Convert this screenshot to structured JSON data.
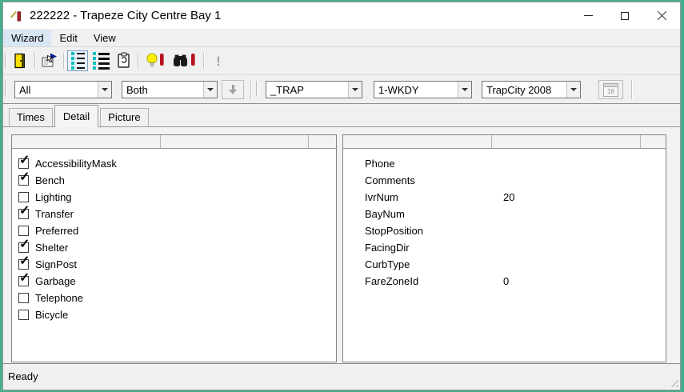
{
  "window": {
    "title": "222222 - Trapeze City Centre Bay 1"
  },
  "menu": {
    "items": [
      {
        "label": "Wizard",
        "active": true
      },
      {
        "label": "Edit",
        "active": false
      },
      {
        "label": "View",
        "active": false
      }
    ]
  },
  "toolbar": {
    "buttons": [
      {
        "icon": "exit-door-icon",
        "pressed": false
      },
      {
        "icon": "properties-hand-card-icon",
        "pressed": false
      },
      {
        "icon": "list-small-icon",
        "pressed": true
      },
      {
        "icon": "list-large-icon",
        "pressed": false
      },
      {
        "icon": "clipboard-icon",
        "pressed": false
      },
      {
        "icon": "lightbulb-alert-icon",
        "pressed": false
      },
      {
        "icon": "binoculars-alert-icon",
        "pressed": false
      },
      {
        "icon": "exclamation-icon-disabled",
        "pressed": false
      }
    ],
    "disabled_exclamation": "!"
  },
  "filter_bar": {
    "combos": [
      {
        "value": "All"
      },
      {
        "value": "Both"
      },
      {
        "value": "_TRAP"
      },
      {
        "value": "1-WKDY"
      },
      {
        "value": "TrapCity 2008"
      }
    ],
    "apply_button": {
      "icon": "down-arrow-icon",
      "enabled": false
    },
    "calendar_button": {
      "icon": "calendar-icon",
      "label": "16",
      "enabled": false
    }
  },
  "tabs": [
    {
      "label": "Times",
      "active": false
    },
    {
      "label": "Detail",
      "active": true
    },
    {
      "label": "Picture",
      "active": false
    }
  ],
  "detail_tab": {
    "checkboxes": [
      {
        "label": "AccessibilityMask",
        "checked": true
      },
      {
        "label": "Bench",
        "checked": true
      },
      {
        "label": "Lighting",
        "checked": false
      },
      {
        "label": "Transfer",
        "checked": true
      },
      {
        "label": "Preferred",
        "checked": false
      },
      {
        "label": "Shelter",
        "checked": true
      },
      {
        "label": "SignPost",
        "checked": true
      },
      {
        "label": "Garbage",
        "checked": true
      },
      {
        "label": "Telephone",
        "checked": false
      },
      {
        "label": "Bicycle",
        "checked": false
      }
    ],
    "check_glyph": "✓",
    "fields": [
      {
        "label": "Phone",
        "value": ""
      },
      {
        "label": "Comments",
        "value": ""
      },
      {
        "label": "IvrNum",
        "value": "20"
      },
      {
        "label": "BayNum",
        "value": ""
      },
      {
        "label": "StopPosition",
        "value": ""
      },
      {
        "label": "FacingDir",
        "value": ""
      },
      {
        "label": "CurbType",
        "value": ""
      },
      {
        "label": "FareZoneId",
        "value": "0"
      }
    ]
  },
  "status_bar": {
    "text": "Ready"
  },
  "colors": {
    "desktop_background": "#45ad8d",
    "toolbar_cyan": "#00c0c0",
    "alert_red": "#b5121b",
    "door_yellow": "#ffe000",
    "bulb_yellow": "#ffef00",
    "menu_highlight": "#d9e7f5",
    "titlebar": "#ffffff",
    "chrome_gray": "#f0f0f0"
  }
}
